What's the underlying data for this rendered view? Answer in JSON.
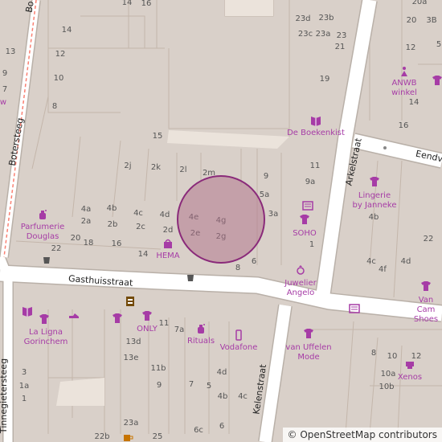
{
  "streets": {
    "boterssteeg": "Botersteeg",
    "bo_top": "Bo",
    "arkelstraat": "Arkelstraat",
    "eendv": "Eendv",
    "gasthuisstraat": "Gasthuisstraat",
    "kelenstraat": "Kelenstraat",
    "tinnegietersteeg": "Tinnegietersteeg"
  },
  "house_numbers": {
    "n14a": "14",
    "n16a": "16",
    "n14b": "14",
    "n13": "13",
    "n12": "12",
    "n9": "9",
    "n10": "10",
    "n7": "7",
    "n8a": "8",
    "n15": "15",
    "n23d": "23d",
    "n23b": "23b",
    "n23c": "23c",
    "n23a": "23a",
    "n23": "23",
    "n21": "21",
    "n19": "19",
    "n20a": "20a",
    "n20": "20",
    "n3B": "3B",
    "n5": "5",
    "n12r": "12",
    "n14r": "14",
    "n16r": "16",
    "n22r": "22",
    "n2j": "2j",
    "n2k": "2k",
    "n2l": "2l",
    "n2m": "2m",
    "n11a": "11",
    "n9b": "9",
    "n9a": "9a",
    "n5a": "5a",
    "n3a": "3a",
    "n1": "1",
    "n4a": "4a",
    "n4b": "4b",
    "n4c": "4c",
    "n4d": "4d",
    "n4e": "4e",
    "n4g": "4g",
    "n2a": "2a",
    "n2b": "2b",
    "n2c": "2c",
    "n2d": "2d",
    "n2e": "2e",
    "n2g": "2g",
    "n20b": "20",
    "n18": "18",
    "n16b": "16",
    "n22": "22",
    "n14c": "14",
    "n8b": "8",
    "n6": "6",
    "n4b2": "4b",
    "n4c2": "4c",
    "n4f": "4f",
    "n4d2": "4d",
    "n11b": "11",
    "n7a": "7a",
    "n13d": "13d",
    "n13e": "13e",
    "n11b2": "11b",
    "n9c": "9",
    "n7b": "7",
    "n5b": "5",
    "n4d3": "4d",
    "n4b3": "4b",
    "n4c3": "4c",
    "n3": "3",
    "n1a": "1a",
    "n1b": "1",
    "n23a2": "23a",
    "n22b": "22b",
    "n25": "25",
    "n6c": "6c",
    "n6b": "6",
    "n8c": "8",
    "n10b": "10",
    "n10a": "10a",
    "n10b2": "10b",
    "n12b": "12"
  },
  "pois": {
    "anwb": "ANWB\nwinkel",
    "boekenkist": "De Boekenkist",
    "parfumerie": "Parfumerie\nDouglas",
    "hema": "HEMA",
    "soho": "SOHO",
    "lingerie": "Lingerie\nby Janneke",
    "juwelier": "Juwelier\nAngelo",
    "vancam": "Van Cam\nShoes",
    "laligna": "La Ligna\nGorinchem",
    "only": "ONLY",
    "rituals": "Rituals",
    "vodafone": "Vodafone",
    "vanuffelen": "van Uffelen\nMode",
    "xenos": "Xenos",
    "w_edge": "w"
  },
  "icons": [
    "book-icon",
    "tshirt-icon",
    "perfume-icon",
    "bag-icon",
    "newspaper-icon",
    "ring-icon",
    "shoe-icon",
    "phone-icon",
    "toilet-icon",
    "waste-basket-icon",
    "lighthouse-icon",
    "cafe-icon"
  ],
  "attribution": "© OpenStreetMap contributors",
  "colors": {
    "building": "#d9d0c9",
    "building_edge": "#c4b6ab",
    "road": "#ffffff",
    "road_casing": "#b9b0a8",
    "poi_text": "#a63ca6",
    "marker_fill": "#b0708a",
    "marker_stroke": "#8a2a7a",
    "footway": "#fa8072"
  }
}
